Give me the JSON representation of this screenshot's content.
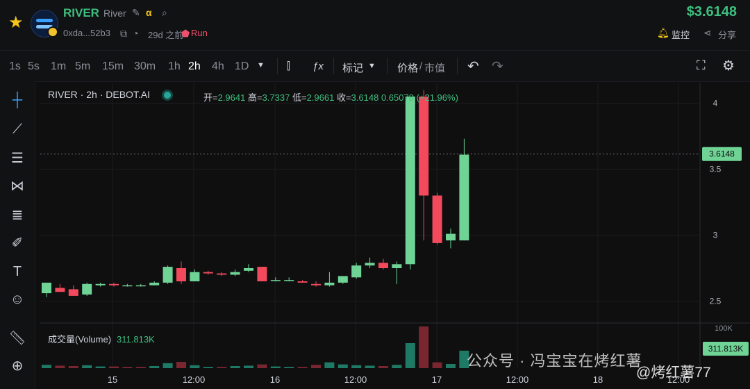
{
  "header": {
    "symbol": "RIVER",
    "name": "River",
    "address": "0xda...52b3",
    "age": "29d 之前",
    "tag": "Run",
    "price": "$3.6148",
    "monitor_label": "监控",
    "share_label": "分享",
    "icons": [
      "star-icon",
      "edit-icon",
      "alpha-icon",
      "search-icon",
      "copy-icon",
      "timer-icon",
      "flame-icon",
      "bell-icon",
      "share-icon"
    ]
  },
  "toolbar": {
    "timeframes": [
      "1s",
      "5s",
      "1m",
      "5m",
      "15m",
      "30m",
      "1h",
      "2h",
      "4h",
      "1D"
    ],
    "active_timeframe": "2h",
    "markers_label": "标记",
    "price_label": "价格",
    "slash": "/",
    "mcap_label": "市值"
  },
  "chart": {
    "legend_title": "RIVER · 2h · DEBOT.AI",
    "ohlc": {
      "open_label": "开=",
      "open": "2.9641",
      "high_label": "高=",
      "high": "3.7337",
      "low_label": "低=",
      "low": "2.9661",
      "close_label": "收=",
      "close": "3.6148",
      "change": "0.65078",
      "change_pct": "(+21.96%)"
    },
    "current_price_label": "3.6148",
    "volume_label": "成交量(Volume)",
    "volume_value": "311.813K",
    "volume_axis_label": "311.813K",
    "volume_axis_top": "100K"
  },
  "watermark": {
    "text": "公众号 · 冯宝宝在烤红薯",
    "badge": "@烤红薯77"
  },
  "colors": {
    "up": "#6fd396",
    "down": "#f24a5c",
    "up_vol": "#1f7a65",
    "down_vol": "#7a2630",
    "accent": "#3fbf7f"
  },
  "chart_data": {
    "type": "candlestick",
    "title": "RIVER · 2h · DEBOT.AI",
    "x_ticks": [
      "15",
      "12:00",
      "16",
      "12:00",
      "17",
      "12:00",
      "18",
      "12:00"
    ],
    "y_ticks": [
      "2.5",
      "3",
      "3.5",
      "4"
    ],
    "ylim": [
      2.35,
      4.15
    ],
    "grid": true,
    "candles": [
      {
        "o": 2.56,
        "h": 2.64,
        "l": 2.53,
        "c": 2.64
      },
      {
        "o": 2.6,
        "h": 2.63,
        "l": 2.58,
        "c": 2.57
      },
      {
        "o": 2.59,
        "h": 2.62,
        "l": 2.54,
        "c": 2.54
      },
      {
        "o": 2.55,
        "h": 2.64,
        "l": 2.54,
        "c": 2.63
      },
      {
        "o": 2.62,
        "h": 2.64,
        "l": 2.61,
        "c": 2.63
      },
      {
        "o": 2.63,
        "h": 2.64,
        "l": 2.61,
        "c": 2.62
      },
      {
        "o": 2.62,
        "h": 2.63,
        "l": 2.61,
        "c": 2.62
      },
      {
        "o": 2.62,
        "h": 2.63,
        "l": 2.61,
        "c": 2.62
      },
      {
        "o": 2.62,
        "h": 2.65,
        "l": 2.62,
        "c": 2.64
      },
      {
        "o": 2.64,
        "h": 2.77,
        "l": 2.63,
        "c": 2.76
      },
      {
        "o": 2.75,
        "h": 2.8,
        "l": 2.63,
        "c": 2.65
      },
      {
        "o": 2.65,
        "h": 2.74,
        "l": 2.65,
        "c": 2.72
      },
      {
        "o": 2.72,
        "h": 2.73,
        "l": 2.7,
        "c": 2.71
      },
      {
        "o": 2.71,
        "h": 2.72,
        "l": 2.69,
        "c": 2.7
      },
      {
        "o": 2.7,
        "h": 2.74,
        "l": 2.69,
        "c": 2.72
      },
      {
        "o": 2.73,
        "h": 2.78,
        "l": 2.72,
        "c": 2.75
      },
      {
        "o": 2.76,
        "h": 2.76,
        "l": 2.65,
        "c": 2.65
      },
      {
        "o": 2.66,
        "h": 2.68,
        "l": 2.65,
        "c": 2.66
      },
      {
        "o": 2.66,
        "h": 2.68,
        "l": 2.65,
        "c": 2.66
      },
      {
        "o": 2.65,
        "h": 2.66,
        "l": 2.64,
        "c": 2.64
      },
      {
        "o": 2.63,
        "h": 2.65,
        "l": 2.61,
        "c": 2.62
      },
      {
        "o": 2.62,
        "h": 2.72,
        "l": 2.61,
        "c": 2.64
      },
      {
        "o": 2.64,
        "h": 2.69,
        "l": 2.63,
        "c": 2.69
      },
      {
        "o": 2.68,
        "h": 2.79,
        "l": 2.67,
        "c": 2.77
      },
      {
        "o": 2.77,
        "h": 2.83,
        "l": 2.75,
        "c": 2.79
      },
      {
        "o": 2.79,
        "h": 2.82,
        "l": 2.74,
        "c": 2.75
      },
      {
        "o": 2.75,
        "h": 2.8,
        "l": 2.63,
        "c": 2.78
      },
      {
        "o": 2.78,
        "h": 4.05,
        "l": 2.74,
        "c": 4.05
      },
      {
        "o": 4.05,
        "h": 4.1,
        "l": 2.96,
        "c": 3.3
      },
      {
        "o": 3.3,
        "h": 3.32,
        "l": 2.93,
        "c": 2.94
      },
      {
        "o": 2.96,
        "h": 3.05,
        "l": 2.9,
        "c": 3.01
      },
      {
        "o": 2.96,
        "h": 3.73,
        "l": 2.96,
        "c": 3.61
      }
    ],
    "volumes": [
      {
        "v": 8,
        "up": true
      },
      {
        "v": 6,
        "up": false
      },
      {
        "v": 5,
        "up": false
      },
      {
        "v": 7,
        "up": true
      },
      {
        "v": 4,
        "up": true
      },
      {
        "v": 4,
        "up": false
      },
      {
        "v": 3,
        "up": false
      },
      {
        "v": 3,
        "up": false
      },
      {
        "v": 5,
        "up": true
      },
      {
        "v": 12,
        "up": true
      },
      {
        "v": 15,
        "up": false
      },
      {
        "v": 7,
        "up": true
      },
      {
        "v": 3,
        "up": true
      },
      {
        "v": 3,
        "up": false
      },
      {
        "v": 5,
        "up": true
      },
      {
        "v": 6,
        "up": true
      },
      {
        "v": 9,
        "up": false
      },
      {
        "v": 4,
        "up": true
      },
      {
        "v": 3,
        "up": true
      },
      {
        "v": 3,
        "up": false
      },
      {
        "v": 8,
        "up": false
      },
      {
        "v": 14,
        "up": true
      },
      {
        "v": 9,
        "up": true
      },
      {
        "v": 7,
        "up": true
      },
      {
        "v": 6,
        "up": true
      },
      {
        "v": 5,
        "up": false
      },
      {
        "v": 8,
        "up": true
      },
      {
        "v": 60,
        "up": true
      },
      {
        "v": 100,
        "up": false
      },
      {
        "v": 14,
        "up": false
      },
      {
        "v": 10,
        "up": true
      },
      {
        "v": 42,
        "up": true
      }
    ],
    "current_price": 3.6148
  }
}
